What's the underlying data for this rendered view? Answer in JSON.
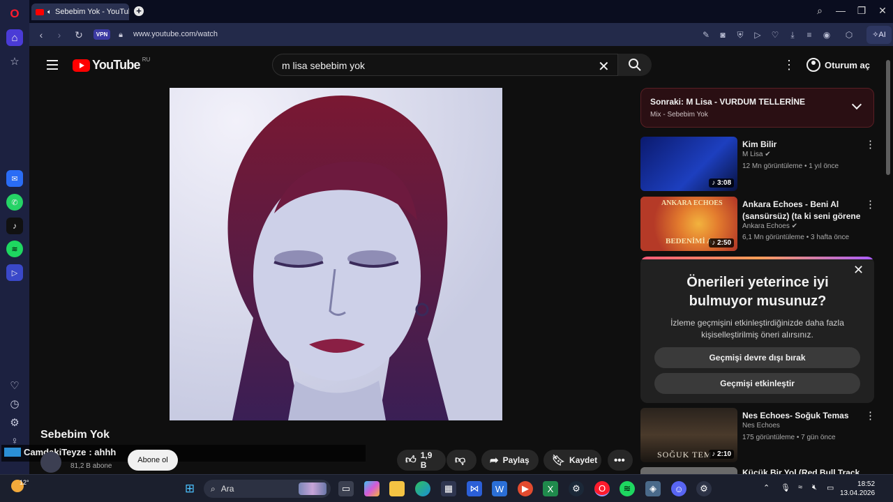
{
  "browser": {
    "tab_title": "Sebebim Yok - YouTube",
    "url": "www.youtube.com/watch",
    "vpn_label": "VPN",
    "ai_label": "AI"
  },
  "sidebar_icons": [
    "opera-icon",
    "home-icon",
    "star-icon",
    "messenger-icon",
    "whatsapp-icon",
    "tiktok-icon",
    "spotify-icon",
    "player-icon",
    "heart-icon",
    "history-icon",
    "settings-icon",
    "lightbulb-icon"
  ],
  "youtube": {
    "logo_text": "YouTube",
    "region": "RU",
    "search_query": "m lisa sebebim yok",
    "sign_in": "Oturum aç"
  },
  "video": {
    "title": "Sebebim Yok",
    "chat_user": "CamdakiTeyze",
    "chat_message": ": ahhh",
    "subscribers": "81,2 B abone",
    "subscribe_label": "Abone ol",
    "likes": "1,9 B",
    "share_label": "Paylaş",
    "save_label": "Kaydet"
  },
  "next_mix": {
    "title": "Sonraki: M Lisa - VURDUM TELLERİNE",
    "subtitle": "Mix - Sebebim Yok"
  },
  "recommendations": [
    {
      "title": "Kim Bilir",
      "channel": "M Lisa",
      "meta": "12 Mn görüntüleme • 1 yıl önce",
      "duration": "3:08"
    },
    {
      "title": "Ankara Echoes - Beni Al (sansürsüz) (ta ki seni görene ...",
      "channel": "Ankara Echoes",
      "meta": "6,1 Mn görüntüleme • 3 hafta önce",
      "duration": "2:50",
      "thumb_text_top": "ANKARA ECHOES",
      "thumb_text_bottom": "BEDENİMİ A"
    },
    {
      "title": "Nes Echoes- Soğuk Temas",
      "channel": "Nes Echoes",
      "meta": "175 görüntüleme • 7 gün önce",
      "duration": "2:10",
      "thumb_text": "SOĞUK TEM"
    },
    {
      "title": "Küçük Bir Yol (Red Bull Track"
    }
  ],
  "prompt": {
    "title": "Önerileri yeterince iyi bulmuyor musunuz?",
    "text": "İzleme geçmişini etkinleştirdiğinizde daha fazla kişiselleştirilmiş öneri alırsınız.",
    "disable_label": "Geçmişi devre dışı bırak",
    "enable_label": "Geçmişi etkinleştir"
  },
  "taskbar": {
    "temperature": "12°",
    "search_placeholder": "Ara",
    "time": "18:52",
    "date": "13.04.2026"
  }
}
